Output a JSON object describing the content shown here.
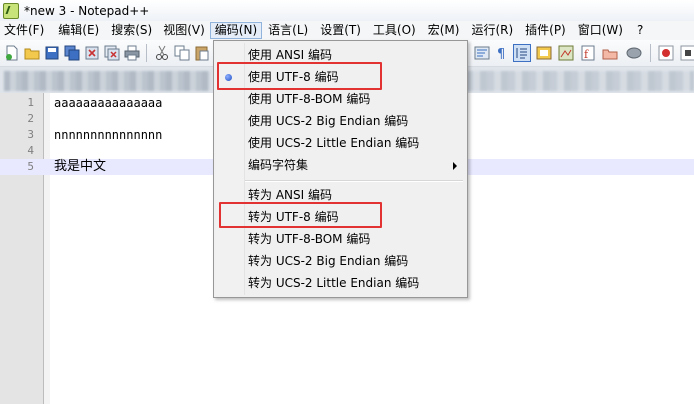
{
  "window": {
    "title": "*new 3 - Notepad++"
  },
  "menubar": {
    "items": [
      "文件(F)",
      "编辑(E)",
      "搜索(S)",
      "视图(V)",
      "编码(N)",
      "语言(L)",
      "设置(T)",
      "工具(O)",
      "宏(M)",
      "运行(R)",
      "插件(P)",
      "窗口(W)",
      "?"
    ],
    "active_index": 4
  },
  "editor": {
    "lines": [
      {
        "number": "1",
        "text": "aaaaaaaaaaaaaaa"
      },
      {
        "number": "2",
        "text": ""
      },
      {
        "number": "3",
        "text": "nnnnnnnnnnnnnnn"
      },
      {
        "number": "4",
        "text": ""
      },
      {
        "number": "5",
        "text": "我是中文"
      }
    ],
    "current_line": 5
  },
  "encoding_menu": {
    "items": [
      {
        "label": "使用 ANSI 编码"
      },
      {
        "label": "使用 UTF-8 编码",
        "checked": true,
        "highlighted": true
      },
      {
        "label": "使用 UTF-8-BOM 编码"
      },
      {
        "label": "使用 UCS-2 Big Endian 编码"
      },
      {
        "label": "使用 UCS-2 Little Endian 编码"
      },
      {
        "label": "编码字符集",
        "submenu": true
      },
      {
        "label": "转为 ANSI 编码"
      },
      {
        "label": "转为 UTF-8 编码",
        "highlighted": true
      },
      {
        "label": "转为 UTF-8-BOM 编码"
      },
      {
        "label": "转为 UCS-2 Big Endian 编码"
      },
      {
        "label": "转为 UCS-2 Little Endian 编码"
      }
    ]
  },
  "toolbar": {
    "icons": [
      "new-file-icon",
      "open-file-icon",
      "save-icon",
      "save-all-icon",
      "close-icon",
      "close-all-icon",
      "print-icon",
      "cut-icon",
      "copy-icon",
      "paste-icon",
      "word-wrap-icon",
      "show-all-chars-icon",
      "indent-guide-icon",
      "doc-map-icon",
      "function-list-icon",
      "folder-workspace-icon",
      "record-macro-icon",
      "stop-record-icon",
      "playback-icon"
    ]
  },
  "colors": {
    "highlight_box": "#e23232",
    "current_line": "#e8e8ff",
    "menu_active": "#e5eef8"
  }
}
